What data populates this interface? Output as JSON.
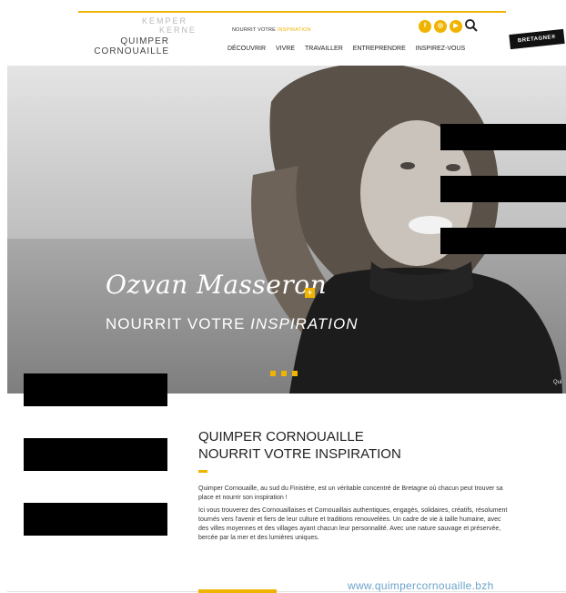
{
  "logo": {
    "kemper": "KEMPER",
    "kerne": "KERNE",
    "quimper": "QUIMPER",
    "cornouaille": "CORNOUAILLE"
  },
  "header": {
    "tagline_prefix": "NOURRIT VOTRE",
    "tagline_accent": "INSPIRATION",
    "bretagne_badge": "BRETAGNE®",
    "social_icons": [
      "facebook-icon",
      "instagram-icon",
      "youtube-icon"
    ],
    "accent_color": "#f0b400"
  },
  "nav": {
    "items": [
      "DÉCOUVRIR",
      "VIVRE",
      "TRAVAILLER",
      "ENTREPRENDRE",
      "INSPIREZ-VOUS"
    ]
  },
  "hero": {
    "name": "Ozvan Masseron",
    "subtitle_prefix": "NOURRIT VOTRE",
    "subtitle_italic": "INSPIRATION",
    "corner_text": "Qui",
    "slides_total": 3
  },
  "content": {
    "heading_line1": "QUIMPER CORNOUAILLE",
    "heading_line2": "NOURRIT VOTRE INSPIRATION",
    "paragraph1": "Quimper Cornouaille, au sud du Finistère, est un véritable concentré de Bretagne où chacun peut trouver sa place et nourrir son inspiration !",
    "paragraph2": "Ici vous trouverez des Cornouaillaises et Cornouaillais authentiques, engagés, solidaires, créatifs, résolument tournés vers l'avenir et fiers de leur culture et traditions renouvelées. Un cadre de vie à taille humaine, avec des villes moyennes et des villages ayant chacun leur personnalité. Avec une nature sauvage et préservée, bercée par la mer et des lumières uniques."
  },
  "footer": {
    "url": "www.quimpercornouaille.bzh"
  }
}
